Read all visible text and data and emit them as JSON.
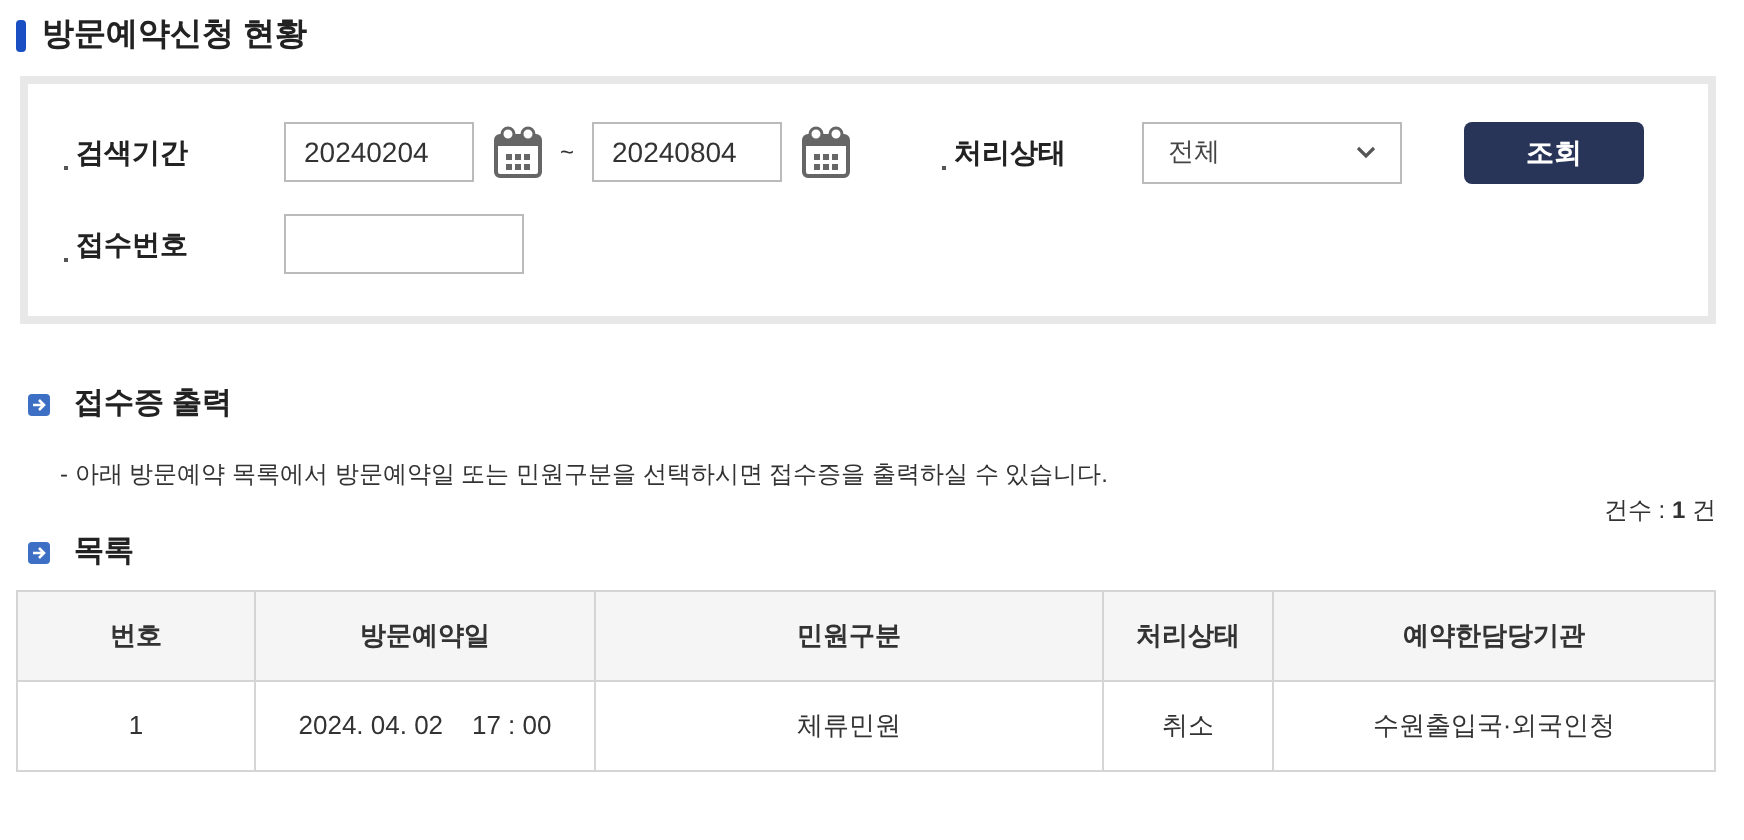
{
  "title": "방문예약신청 현황",
  "search": {
    "period_label": "검색기간",
    "date_from": "20240204",
    "separator": "~",
    "date_to": "20240804",
    "status_label": "처리상태",
    "status_value": "전체",
    "search_button": "조회",
    "receipt_label": "접수번호"
  },
  "receipt_section": {
    "heading": "접수증 출력",
    "description": "- 아래 방문예약 목록에서 방문예약일 또는 민원구분을 선택하시면 접수증을 출력하실 수 있습니다."
  },
  "count": {
    "label": "건수 : ",
    "value": "1",
    "unit": " 건"
  },
  "list_heading": "목록",
  "table": {
    "columns": [
      "번호",
      "방문예약일",
      "민원구분",
      "처리상태",
      "예약한담당기관"
    ],
    "rows": [
      [
        "1",
        "2024. 04. 02    17 : 00",
        "체류민원",
        "취소",
        "수원출입국·외국인청"
      ]
    ]
  }
}
